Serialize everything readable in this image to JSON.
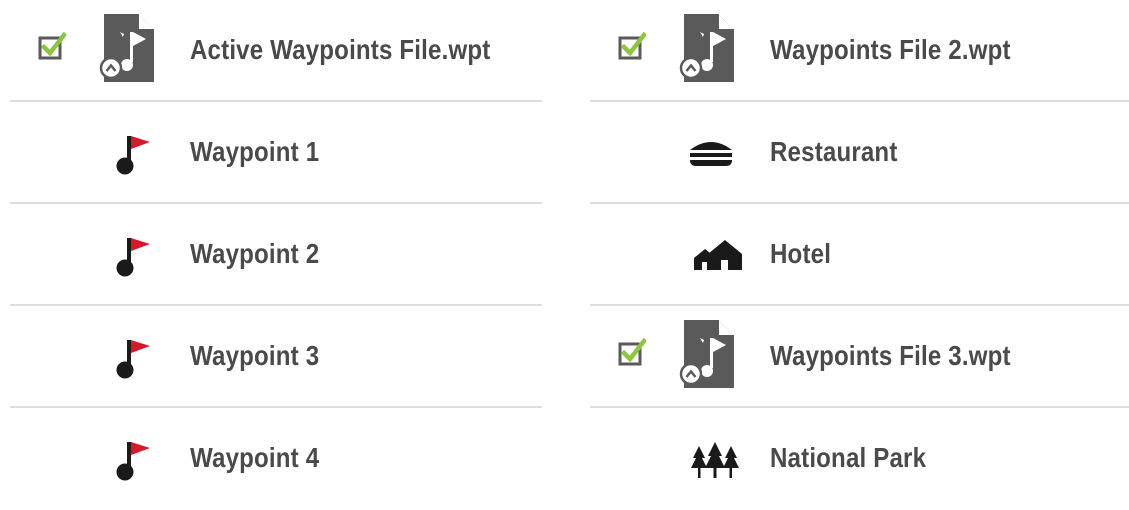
{
  "colors": {
    "flag_red": "#d7182a",
    "check_green": "#8cc63f",
    "text": "#4a4a4a",
    "divider": "#dcdcdc",
    "file_gray": "#5a5a5a"
  },
  "left_list": {
    "file": {
      "name": "Active Waypoints File.wpt",
      "checked": true,
      "icon": "waypoint-file-icon"
    },
    "items": [
      {
        "label": "Waypoint 1",
        "icon": "red-flag-icon"
      },
      {
        "label": "Waypoint 2",
        "icon": "red-flag-icon"
      },
      {
        "label": "Waypoint 3",
        "icon": "red-flag-icon"
      },
      {
        "label": "Waypoint 4",
        "icon": "red-flag-icon"
      }
    ]
  },
  "right_list": {
    "file2": {
      "name": "Waypoints File 2.wpt",
      "checked": true,
      "icon": "waypoint-file-icon"
    },
    "file2_items": [
      {
        "label": "Restaurant",
        "icon": "restaurant-icon"
      },
      {
        "label": "Hotel",
        "icon": "hotel-icon"
      }
    ],
    "file3": {
      "name": "Waypoints File 3.wpt",
      "checked": true,
      "icon": "waypoint-file-icon"
    },
    "file3_items": [
      {
        "label": "National Park",
        "icon": "national-park-icon"
      }
    ]
  }
}
